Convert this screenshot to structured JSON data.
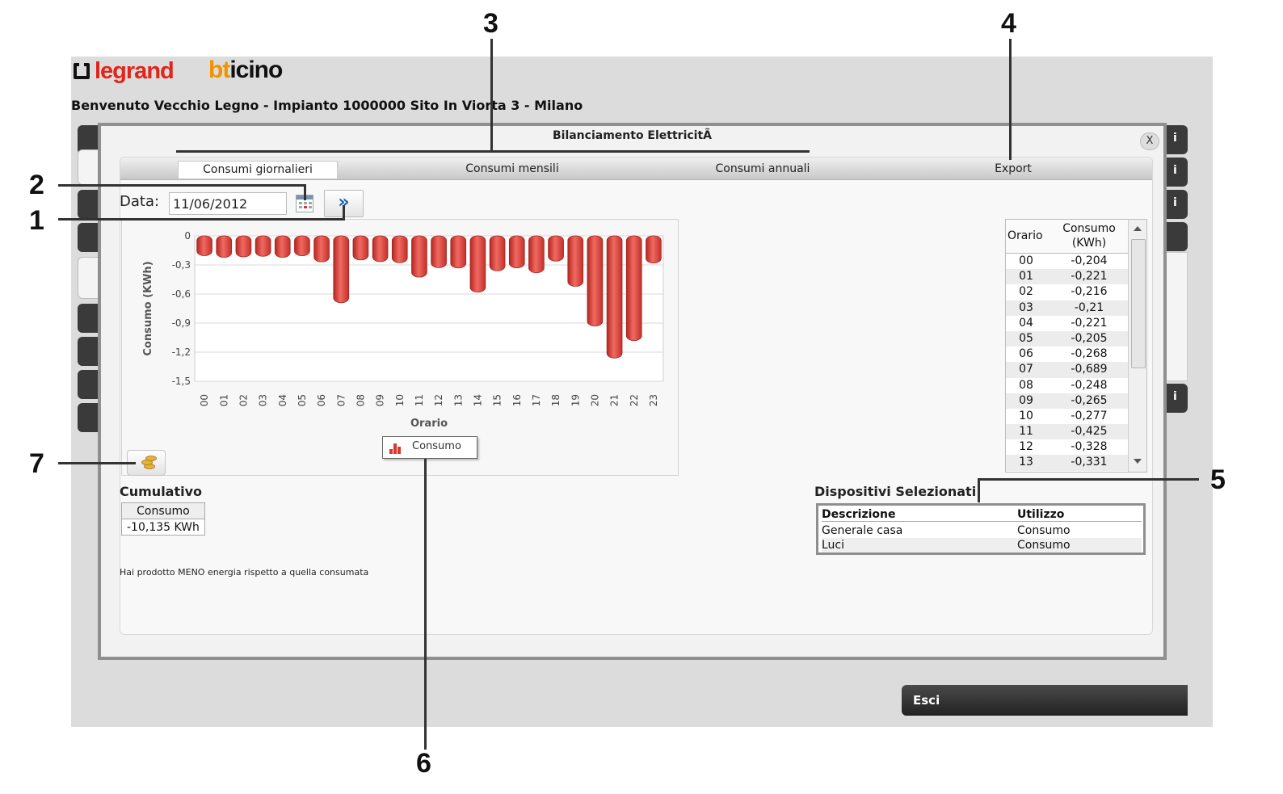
{
  "callouts": [
    "1",
    "2",
    "3",
    "4",
    "5",
    "6",
    "7"
  ],
  "brand": {
    "legrand": "legrand",
    "bticino_b": "bt",
    "bticino_rest": "icino"
  },
  "header": {
    "welcome": "Benvenuto Vecchio Legno - Impianto 1000000 Sito In Viorta 3 - Milano"
  },
  "modal": {
    "title": "Bilanciamento ElettricitÃ",
    "close_label": "X",
    "tabs": [
      "Consumi giornalieri",
      "Consumi mensili",
      "Consumi annuali",
      "Export"
    ],
    "date_label": "Data:",
    "date_value": "11/06/2012",
    "next_label": "»"
  },
  "chart_data": {
    "type": "bar",
    "ylabel": "Consumo (KWh)",
    "xlabel": "Orario",
    "ylim": [
      -1.5,
      0
    ],
    "yticks": [
      "0",
      "-0,3",
      "-0,6",
      "-0,9",
      "-1,2",
      "-1,5"
    ],
    "categories": [
      "00",
      "01",
      "02",
      "03",
      "04",
      "05",
      "06",
      "07",
      "08",
      "09",
      "10",
      "11",
      "12",
      "13",
      "14",
      "15",
      "16",
      "17",
      "18",
      "19",
      "20",
      "21",
      "22",
      "23"
    ],
    "series": [
      {
        "name": "Consumo",
        "values": [
          -0.204,
          -0.221,
          -0.216,
          -0.21,
          -0.221,
          -0.205,
          -0.268,
          -0.689,
          -0.248,
          -0.265,
          -0.277,
          -0.425,
          -0.328,
          -0.331,
          -0.58,
          -0.36,
          -0.33,
          -0.38,
          -0.26,
          -0.52,
          -0.93,
          -1.26,
          -1.08,
          -0.28
        ]
      }
    ],
    "grid": true,
    "legend": "bottom-center",
    "bar_color": "#e8403a"
  },
  "cumulative": {
    "title": "Cumulativo",
    "header": "Consumo",
    "value": "-10,135 KWh"
  },
  "summary_message": "Hai prodotto MENO energia rispetto a quella consumata",
  "hourly_table": {
    "col_hour": "Orario",
    "col_consumption": "Consumo (KWh)",
    "rows": [
      {
        "h": "00",
        "v": "-0,204"
      },
      {
        "h": "01",
        "v": "-0,221"
      },
      {
        "h": "02",
        "v": "-0,216"
      },
      {
        "h": "03",
        "v": "-0,21"
      },
      {
        "h": "04",
        "v": "-0,221"
      },
      {
        "h": "05",
        "v": "-0,205"
      },
      {
        "h": "06",
        "v": "-0,268"
      },
      {
        "h": "07",
        "v": "-0,689"
      },
      {
        "h": "08",
        "v": "-0,248"
      },
      {
        "h": "09",
        "v": "-0,265"
      },
      {
        "h": "10",
        "v": "-0,277"
      },
      {
        "h": "11",
        "v": "-0,425"
      },
      {
        "h": "12",
        "v": "-0,328"
      },
      {
        "h": "13",
        "v": "-0,331"
      }
    ]
  },
  "devices": {
    "title": "Dispositivi Selezionati",
    "col_desc": "Descrizione",
    "col_use": "Utilizzo",
    "rows": [
      {
        "desc": "Generale casa",
        "use": "Consumo"
      },
      {
        "desc": "Luci",
        "use": "Consumo"
      }
    ]
  },
  "side_tab_labels": [
    "i",
    "i",
    "i",
    "i"
  ],
  "exit_label": "Esci"
}
